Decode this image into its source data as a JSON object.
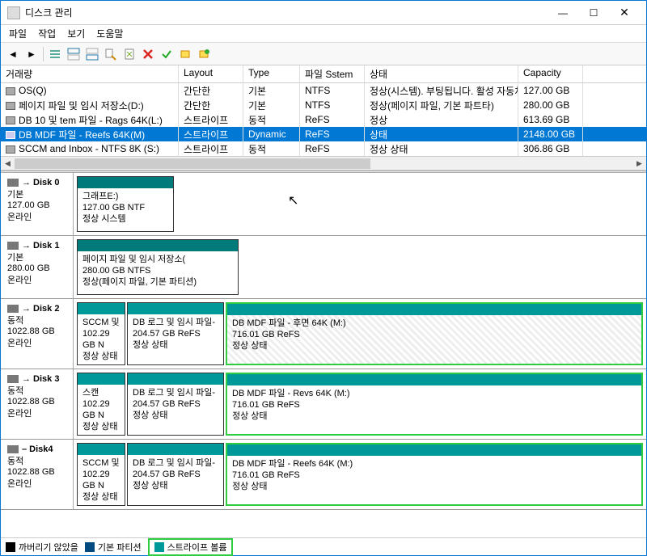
{
  "window": {
    "title": "디스크 관리"
  },
  "menu": {
    "file": "파일",
    "action": "작업",
    "view": "보기",
    "help": "도움말"
  },
  "table": {
    "headers": {
      "volume": "거래량",
      "layout": "Layout",
      "type": "Type",
      "fs": "파일 Sstem",
      "status": "상태",
      "capacity": "Capacity"
    },
    "rows": [
      {
        "name": "OS(Q)",
        "layout": "간단한",
        "type": "기본",
        "fs": "NTFS",
        "status": "정상(시스템). 부팅됩니다. 활성 자동차",
        "capacity": "127.00 GB"
      },
      {
        "name": "페이지 파일 및 임시 저장소(D:)",
        "layout": "간단한",
        "type": "기본",
        "fs": "NTFS",
        "status": "정상(페이지 파일, 기본 파트타)",
        "capacity": "280.00 GB"
      },
      {
        "name": "DB 10 및 tem 파일 - Rags 64K(L:)",
        "layout": "스트라이프",
        "type": "동적",
        "fs": "ReFS",
        "status": "정상",
        "capacity": "613.69 GB"
      },
      {
        "name": "DB MDF 파일 - Reefs 64K(M)",
        "layout": "스트라이프",
        "type": "Dynamic",
        "fs": "ReFS",
        "status": "상태",
        "capacity": "2148.00 GB"
      },
      {
        "name": "SCCM and Inbox - NTFS 8K (S:)",
        "layout": "스트라이프",
        "type": "동적",
        "fs": "ReFS",
        "status": "정상 상태",
        "capacity": "306.86 GB"
      }
    ]
  },
  "disks": [
    {
      "name": "Disk 0",
      "prefix": "→",
      "type": "기본",
      "size": "127.00 GB",
      "status": "온라인",
      "vols": [
        {
          "title": "그래프E:)",
          "line2": "127.00 GB NTF",
          "line3": "정상 시스템",
          "wclass": "vol-w-120",
          "stripe": false
        }
      ]
    },
    {
      "name": "Disk 1",
      "prefix": "→",
      "type": "기본",
      "size": "280.00 GB",
      "status": "온라인",
      "vols": [
        {
          "title": "페이지 파일 및 임시 저장소(",
          "line2": "280.00 GB NTFS",
          "line3": "정상(페이지 파일, 기본 파티션)",
          "wclass": "vol-w-200",
          "stripe": false
        }
      ]
    },
    {
      "name": "Disk 2",
      "prefix": "→",
      "type": "동적",
      "size": "1022.88 GB",
      "status": "온라인",
      "vols": [
        {
          "title": "SCCM 및",
          "line2": "102.29 GB N",
          "line3": "정상 상태",
          "wclass": "vol-w-60",
          "stripe": true
        },
        {
          "title": "DB 로그 및 임시 파일-",
          "line2": "204.57 GB ReFS",
          "line3": "정상 상태",
          "wclass": "vol-w-120",
          "stripe": true
        },
        {
          "title": "DB MDF 파일 - 후면 64K    (M:)",
          "line2": "716.01 GB ReFS",
          "line3": "정상 상태",
          "wclass": "vol-flex",
          "stripe": true,
          "hatch": true,
          "green": true
        }
      ]
    },
    {
      "name": "Disk 3",
      "prefix": "→",
      "type": "동적",
      "size": "1022.88 GB",
      "status": "온라인",
      "vols": [
        {
          "title": "스캔",
          "line2": "102.29 GB N",
          "line3": "정상 상태",
          "wclass": "vol-w-60",
          "stripe": true
        },
        {
          "title": "DB 로그 및 임시 파일-",
          "line2": "204.57 GB ReFS",
          "line3": "정상 상태",
          "wclass": "vol-w-120",
          "stripe": true
        },
        {
          "title": "DB MDF 파일 - Revs 64K    (M:)",
          "line2": "716.01 GB ReFS",
          "line3": "정상 상태",
          "wclass": "vol-flex",
          "stripe": true,
          "green": true
        }
      ]
    },
    {
      "name": "Disk4",
      "prefix": "–",
      "type": "동적",
      "size": "1022.88 GB",
      "status": "온라인",
      "vols": [
        {
          "title": "SCCM 및",
          "line2": "102.29 GB N",
          "line3": "정상 상태",
          "wclass": "vol-w-60",
          "stripe": true
        },
        {
          "title": "DB 로그 및 임시 파일-",
          "line2": "204.57 GB ReFS",
          "line3": "정상 상태",
          "wclass": "vol-w-120",
          "stripe": true
        },
        {
          "title": "DB MDF 파일 - Reefs 64K    (M:)",
          "line2": "716.01 GB ReFS",
          "line3": "정상 상태",
          "wclass": "vol-flex",
          "stripe": true,
          "green": true
        }
      ]
    }
  ],
  "legend": {
    "unalloc": "까버리기 않았을",
    "primary": "기본 파티션",
    "stripe": "스트라이프 볼륨"
  }
}
